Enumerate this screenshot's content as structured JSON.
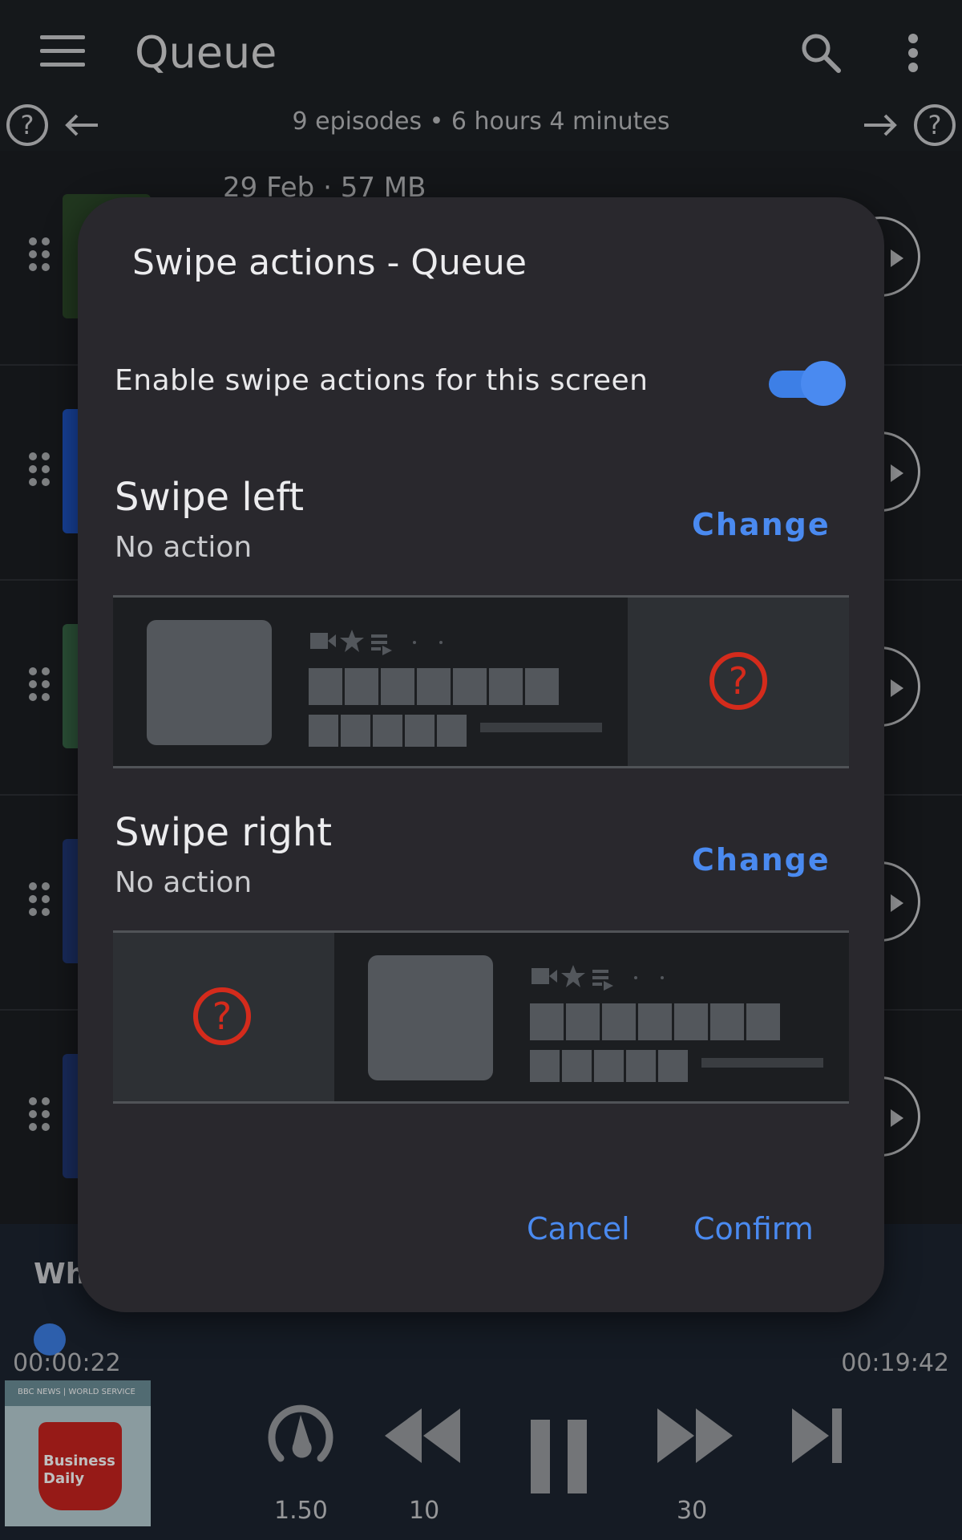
{
  "appbar": {
    "title": "Queue",
    "icons": [
      "menu-icon",
      "search-icon",
      "more-vert-icon"
    ]
  },
  "subbar": {
    "summary": "9 episodes • 6 hours 4 minutes"
  },
  "queue": {
    "first_meta": "29 Feb · 57 MB",
    "thumb_colors": [
      "#2d4a2a",
      "#1f56c9",
      "#3a6b4a",
      "#223a7a",
      "#223a7a"
    ]
  },
  "dialog": {
    "title": "Swipe actions - Queue",
    "enable_label": "Enable swipe actions for this screen",
    "enable_state": true,
    "swipe_left": {
      "title": "Swipe left",
      "action": "No action",
      "change": "Change"
    },
    "swipe_right": {
      "title": "Swipe right",
      "action": "No action",
      "change": "Change"
    },
    "cancel": "Cancel",
    "confirm": "Confirm"
  },
  "player": {
    "title": "Why",
    "progress_fraction": 0.019,
    "elapsed": "00:00:22",
    "remaining": "00:19:42",
    "cover": {
      "header": "BBC NEWS | WORLD SERVICE",
      "text": "Business Daily"
    },
    "speed": "1.50",
    "rewind": "10",
    "forward": "30"
  },
  "colors": {
    "accent": "#4a8af0",
    "help_red": "#d42b1c",
    "dialog_bg": "#29282d"
  }
}
